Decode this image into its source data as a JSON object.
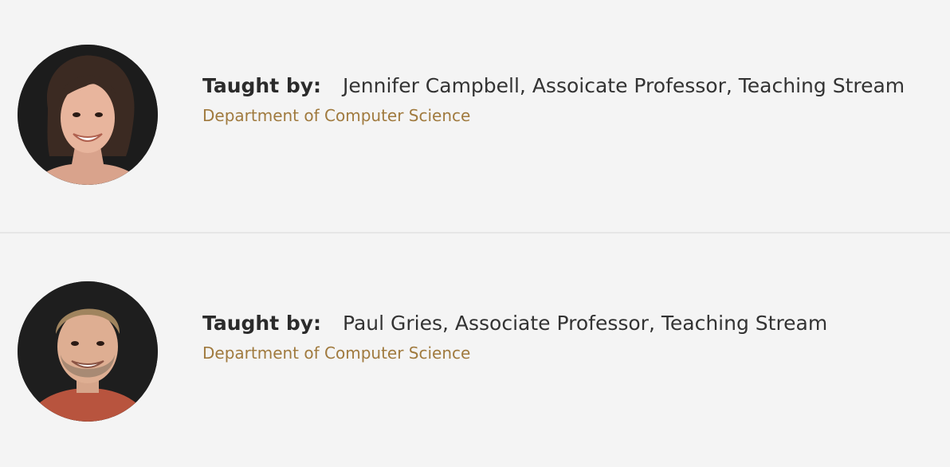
{
  "instructors": [
    {
      "label": "Taught by:",
      "name": "Jennifer Campbell, Assoicate Professor, Teaching Stream",
      "department": "Department of Computer Science",
      "photo_icon": "instructor-photo-woman"
    },
    {
      "label": "Taught by:",
      "name": "Paul Gries, Associate Professor, Teaching Stream",
      "department": "Department of Computer Science",
      "photo_icon": "instructor-photo-man"
    }
  ],
  "colors": {
    "background": "#f4f4f4",
    "text": "#333333",
    "link": "#a07a3e",
    "divider": "#e6e6e6"
  }
}
